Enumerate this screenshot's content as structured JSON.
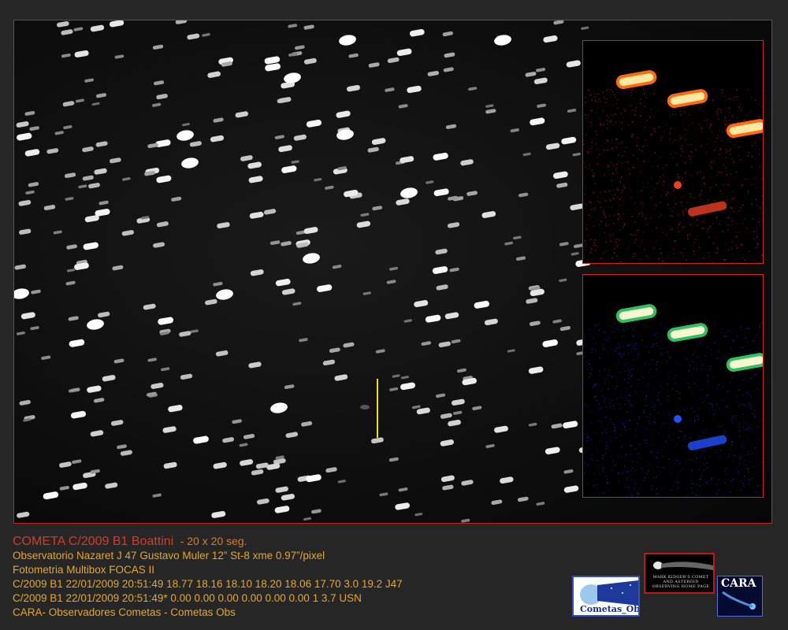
{
  "caption": {
    "title": "COMETA C/2009 B1 Boattini",
    "exposure": "- 20 x 20 seg.",
    "lines": [
      "Observatorio Nazaret J 47 Gustavo Muler 12” St-8 xme 0.97”/pixel",
      "Fotometria Multibox FOCAS II",
      "C/2009 B1 22/01/2009 20:51:49 18.77 18.16 18.10 18.20 18.06 17.70 3.0 19.2 J47",
      "C/2009 B1 22/01/2009 20:51:49* 0.00 0.00 0.00 0.00 0.00 0.00 1 3.7 USN",
      "CARA- Observadores Cometas - Cometas Obs"
    ]
  },
  "logos": {
    "cometas_obs": "Cometas_Obs",
    "kidger": "MARK KIDGER'S COMET AND ASTEROID OBSERVING HOME PAGE",
    "cara": "CARA"
  },
  "colors": {
    "frame_border": "#d02020",
    "comet_marker": "#e8e020",
    "title": "#d83a2a",
    "text": "#e8a628"
  }
}
